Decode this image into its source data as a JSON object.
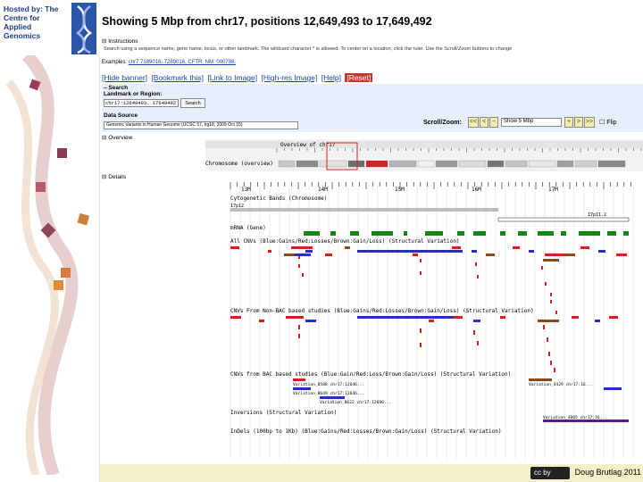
{
  "sidebar": {
    "hosted_by": "Hosted by: The Centre for Applied Genomics"
  },
  "header": {
    "title": "Showing 5 Mbp from chr17, positions 12,649,493 to 17,649,492"
  },
  "instructions": {
    "heading": "⊟ Instructions",
    "text": "Search using a sequence name, gene name, locus, or other landmark. The wildcard character * is allowed. To center on a location, click the ruler. Use the Scroll/Zoom buttons to change",
    "examples_label": "Examples:",
    "examples": "chr7:7189016..7289016, CFTR, NM_000798."
  },
  "links": {
    "hide_banner": "[Hide banner]",
    "bookmark": "[Bookmark this]",
    "link_image": "[Link to Image]",
    "hires": "[High-res Image]",
    "help": "[Help]",
    "reset": "[Reset]"
  },
  "search_panel": {
    "heading": "– Search",
    "landmark_label": "Landmark or Region:",
    "region_value": "chr17:12649493..17649492",
    "search_button": "Search",
    "data_source_label": "Data Source",
    "data_source_value": "Genomic Variants in Human Genome (UCSC 57, hg18, 2009 Oct 15)",
    "scroll_zoom_label": "Scroll/Zoom:",
    "zoom_value": "Show 5 Mbp",
    "flip_label": "Flip",
    "btn_left2": "<<",
    "btn_left1": "<",
    "btn_minus": "−",
    "btn_plus": "+",
    "btn_right1": ">",
    "btn_right2": ">>"
  },
  "overview": {
    "heading": "⊟ Overview",
    "track_title": "Overview of chr17",
    "row_label": "Chromosome (overview)"
  },
  "details": {
    "heading": "⊟ Details",
    "ruler_labels": [
      "13M",
      "14M",
      "15M",
      "16M",
      "17M"
    ],
    "cytoband_track": "Cytogenetic Bands (Chromosome)",
    "cyto_left": "17p12",
    "cyto_right": "17p11.2",
    "refgene_track": "mRNA (Gene)",
    "all_cnvs_track": "All CNVs (Blue:Gains/Red:Losses/Brown:Gain/Loss) (Structural Variation)",
    "nonbac_track": "CNVs From Non-BAC based studies (Blue:Gains/Red:Losses/Brown:Gain/Loss) (Structural Variation)",
    "bac_track": "CNVs from BAC based studies (Blue:Gain/Red:Loss/Brown:Gain/Loss) (Structural Variation)",
    "inversion_track": "Inversions (Structural Variation)",
    "indels_track": "InDels (100bp to 1Kb) (Blue:Gains/Red:Losses/Brown:Gain/Loss) (Structural Variation)",
    "bac_row1": "Variation_0588 chr17:12646...",
    "bac_row2": "Variation_0649 chr17:12646...",
    "bac_row3": "Variation_0622 chr17:12690...",
    "bac_far_right": "Variation_4429 chr17:16...",
    "inv_label": "Variation_4805 chr17:16..."
  },
  "footer": {
    "credit": "Doug Brutlag 2011",
    "cc_text": "cc by"
  },
  "colors": {
    "panel_bg": "#e7efff",
    "gain": "#2a2fbf",
    "loss": "#d62020",
    "gainloss": "#8a4a1a",
    "gene": "#118a11",
    "link": "#1a3fb0"
  }
}
